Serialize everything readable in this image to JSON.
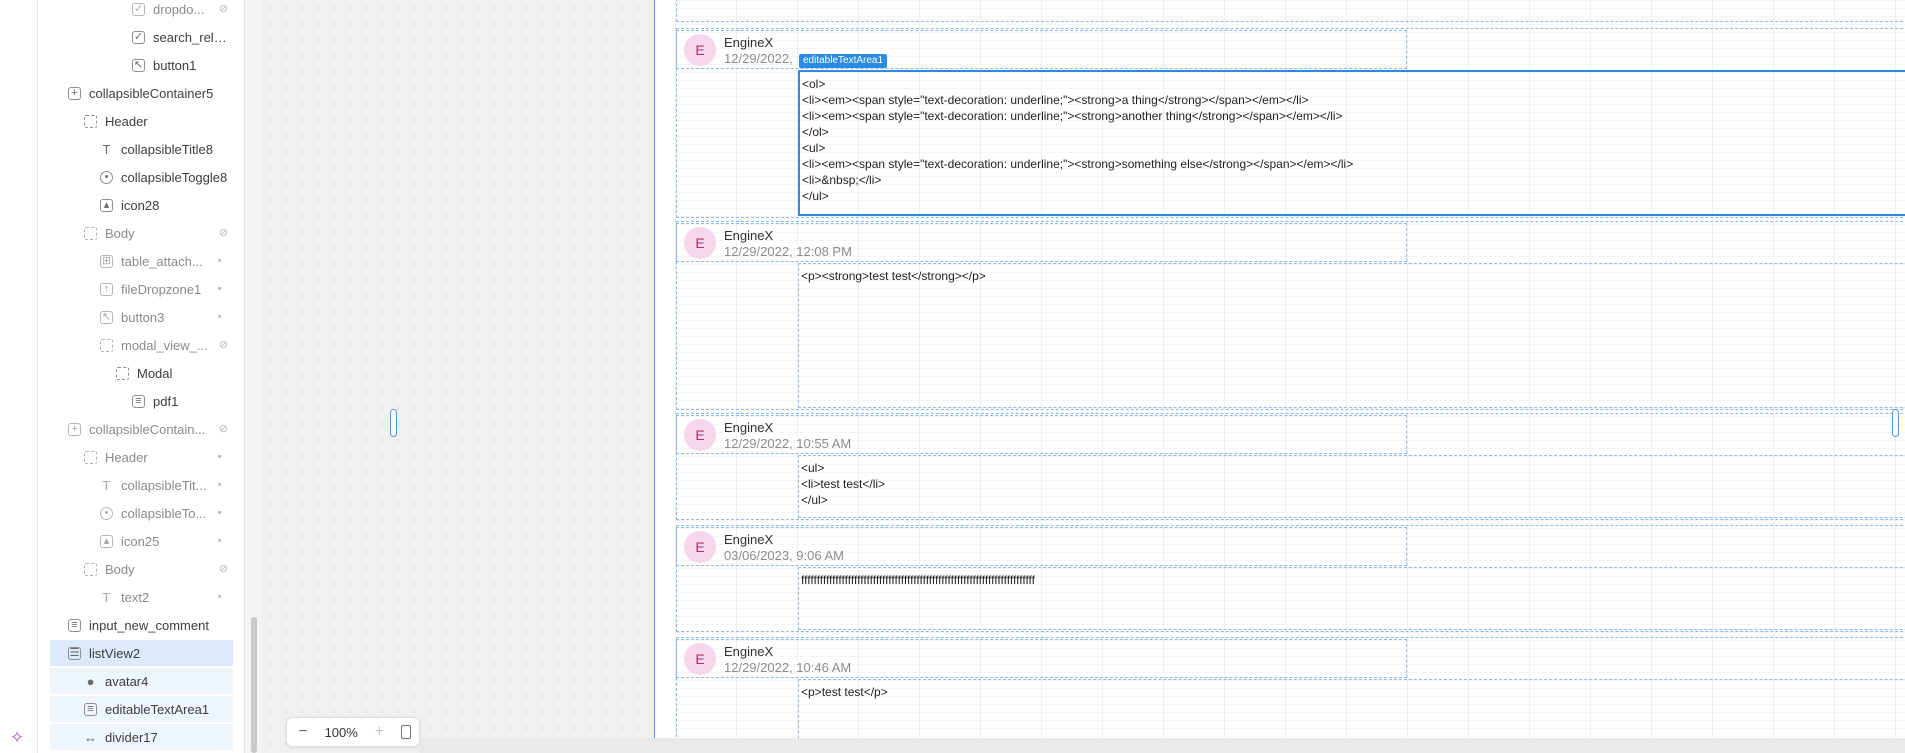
{
  "tree": {
    "items": [
      {
        "label": "dropdo...",
        "icon": "checkbox-icon",
        "trail": "eye-off-icon"
      },
      {
        "label": "search_relat...",
        "icon": "checkbox-icon"
      },
      {
        "label": "button1",
        "icon": "cursor-icon"
      },
      {
        "label": "collapsibleContainer5",
        "icon": "container-icon"
      },
      {
        "label": "Header",
        "icon": "frame-icon"
      },
      {
        "label": "collapsibleTitle8",
        "icon": "text-icon"
      },
      {
        "label": "collapsibleToggle8",
        "icon": "toggle-icon"
      },
      {
        "label": "icon28",
        "icon": "image-icon"
      },
      {
        "label": "Body",
        "icon": "frame-icon",
        "trail": "eye-off-icon"
      },
      {
        "label": "table_attach...",
        "icon": "table-icon"
      },
      {
        "label": "fileDropzone1",
        "icon": "dropzone-icon"
      },
      {
        "label": "button3",
        "icon": "cursor-icon"
      },
      {
        "label": "modal_view_...",
        "icon": "modal-icon",
        "trail": "eye-off-icon"
      },
      {
        "label": "Modal",
        "icon": "frame-icon"
      },
      {
        "label": "pdf1",
        "icon": "pdf-icon"
      },
      {
        "label": "collapsibleContain...",
        "icon": "container-icon",
        "trail": "eye-off-icon"
      },
      {
        "label": "Header",
        "icon": "frame-icon"
      },
      {
        "label": "collapsibleTit...",
        "icon": "text-icon"
      },
      {
        "label": "collapsibleTo...",
        "icon": "toggle-icon"
      },
      {
        "label": "icon25",
        "icon": "image-icon"
      },
      {
        "label": "Body",
        "icon": "frame-icon",
        "trail": "eye-off-icon"
      },
      {
        "label": "text2",
        "icon": "text-icon"
      },
      {
        "label": "input_new_comment",
        "icon": "input-icon"
      },
      {
        "label": "listView2",
        "icon": "list-icon"
      },
      {
        "label": "avatar4",
        "icon": "avatar-icon"
      },
      {
        "label": "editableTextArea1",
        "icon": "input-icon"
      },
      {
        "label": "divider17",
        "icon": "divider-icon"
      }
    ]
  },
  "zoom": {
    "level": "100%"
  },
  "selected_tag": "editableTextArea1",
  "comments": [
    {
      "avatar": "E",
      "name": "EngineX",
      "date": "12/29/2022,",
      "text": "<ol>\n<li><em><span style=\"text-decoration: underline;\"><strong>a thing</strong></span></em></li>\n<li><em><span style=\"text-decoration: underline;\"><strong>another thing</strong></span></em></li>\n</ol>\n<ul>\n<li><em><span style=\"text-decoration: underline;\"><strong>something else</strong></span></em></li>\n<li>&nbsp;</li>\n</ul>"
    },
    {
      "avatar": "E",
      "name": "EngineX",
      "date": "12/29/2022, 12:08 PM",
      "text": "<p><strong>test test</strong></p>"
    },
    {
      "avatar": "E",
      "name": "EngineX",
      "date": "12/29/2022, 10:55 AM",
      "text": "<ul>\n<li>test test</li>\n</ul>"
    },
    {
      "avatar": "E",
      "name": "EngineX",
      "date": "03/06/2023, 9:06 AM",
      "text": "fffffffffffffffffffffffffffffffffffffffffffffffffffffffffffffffffffffffffff"
    },
    {
      "avatar": "E",
      "name": "EngineX",
      "date": "12/29/2022, 10:46 AM",
      "text": "<p>test test</p>"
    }
  ]
}
